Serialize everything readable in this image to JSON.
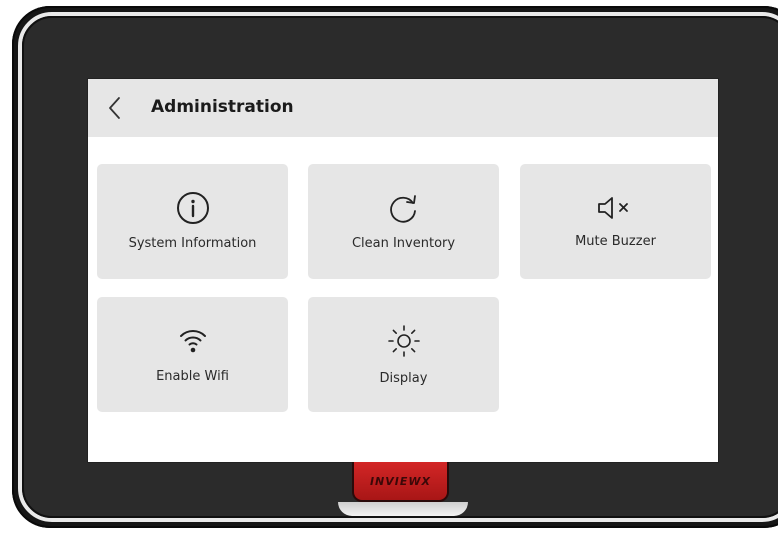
{
  "header": {
    "title": "Administration"
  },
  "tiles": [
    {
      "label": "System Information",
      "icon": "info-icon"
    },
    {
      "label": "Clean Inventory",
      "icon": "refresh-icon"
    },
    {
      "label": "Mute Buzzer",
      "icon": "speaker-mute-icon"
    },
    {
      "label": "Enable Wifi",
      "icon": "wifi-icon"
    },
    {
      "label": "Display",
      "icon": "brightness-icon"
    }
  ],
  "device": {
    "brand": "INVIEWX"
  },
  "colors": {
    "header_bg": "#e6e6e6",
    "tile_bg": "#e6e6e6",
    "bezel": "#2b2b2b",
    "logo_red": "#c41e1e"
  }
}
